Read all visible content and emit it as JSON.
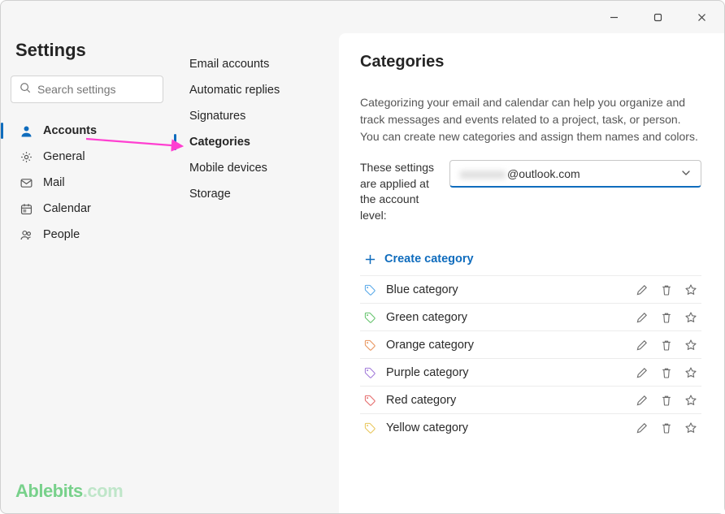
{
  "window": {
    "title": "Settings"
  },
  "search": {
    "placeholder": "Search settings"
  },
  "sidebar": {
    "items": [
      {
        "label": "Accounts"
      },
      {
        "label": "General"
      },
      {
        "label": "Mail"
      },
      {
        "label": "Calendar"
      },
      {
        "label": "People"
      }
    ]
  },
  "subnav": {
    "items": [
      {
        "label": "Email accounts"
      },
      {
        "label": "Automatic replies"
      },
      {
        "label": "Signatures"
      },
      {
        "label": "Categories"
      },
      {
        "label": "Mobile devices"
      },
      {
        "label": "Storage"
      }
    ]
  },
  "main": {
    "title": "Categories",
    "description": "Categorizing your email and calendar can help you organize and track messages and events related to a project, task, or person. You can create new categories and assign them names and colors.",
    "account_label": "These settings are applied at the account level:",
    "account_domain": "@outlook.com",
    "create_label": "Create category",
    "categories": [
      {
        "name": "Blue category",
        "color": "#57a8e8"
      },
      {
        "name": "Green category",
        "color": "#63c36b"
      },
      {
        "name": "Orange category",
        "color": "#e8935a"
      },
      {
        "name": "Purple category",
        "color": "#a179d9"
      },
      {
        "name": "Red category",
        "color": "#e56a6a"
      },
      {
        "name": "Yellow category",
        "color": "#e8c65a"
      }
    ]
  },
  "watermark": {
    "a": "Ablebits",
    "b": ".com"
  }
}
